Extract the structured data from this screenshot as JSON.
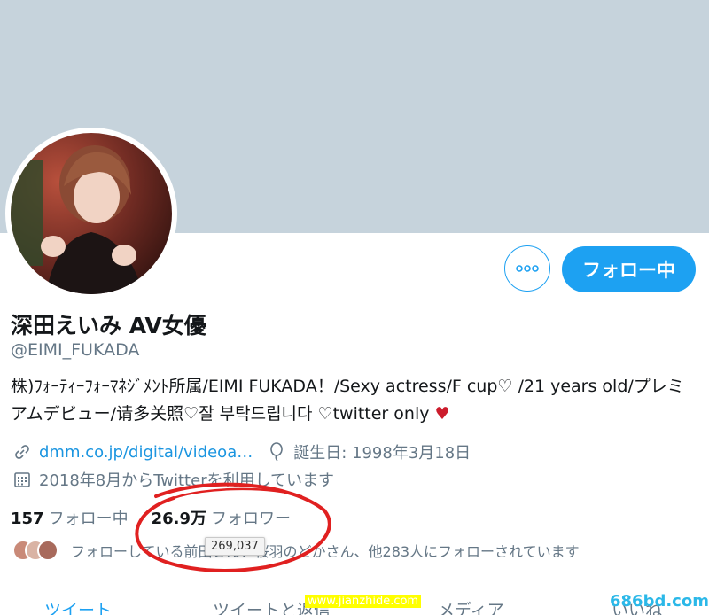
{
  "profile": {
    "name": "深田えいみ AV女優",
    "handle": "@EIMI_FUKADA",
    "bio_text": "株)ﾌｫｰﾃｨｰﾌｫｰﾏﾈｼﾞﾒﾝﾄ所属/EIMI FUKADA！/Sexy actress/F cup♡ /21 years old/プレミアムデビュー/请多关照♡잘 부탁드립니다 ♡twitter only ",
    "bio_heart": "♥",
    "website": "dmm.co.jp/digital/videoa…",
    "birthday": "誕生日: 1998年3月18日",
    "joined": "2018年8月からTwitterを利用しています"
  },
  "actions": {
    "follow_label": "フォロー中",
    "more_icon": "more-horizontal-icon"
  },
  "stats": {
    "following_count": "157",
    "following_label": "フォロー中",
    "followers_count": "26.9万",
    "followers_label": "フォロワー",
    "followers_tooltip": "269,037"
  },
  "known_followers": "フォローしている前田さん、桜羽のどかさん、他283人にフォローされています",
  "tabs": [
    "ツイート",
    "ツイートと返信",
    "メディア",
    "いいね"
  ],
  "watermarks": {
    "center": "www.jianzhide.com",
    "corner": "686bd.com"
  },
  "colors": {
    "banner": "#c6d3dc",
    "accent": "#1da1f2",
    "link": "#1b95e0",
    "annotation_circle": "#e02020"
  }
}
